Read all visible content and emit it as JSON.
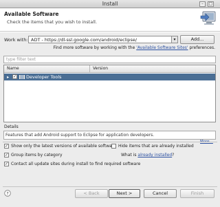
{
  "window": {
    "title": "Install"
  },
  "header": {
    "title": "Available Software",
    "subtitle": "Check the items that you wish to install."
  },
  "work_with": {
    "label": "Work with:",
    "value": "ADT - https://dl-ssl.google.com/android/eclipse/",
    "add_button": "Add...",
    "hint_prefix": "Find more software by working with the",
    "hint_link": "'Available Software Sites'",
    "hint_suffix": "preferences."
  },
  "filter": {
    "placeholder": "type filter text"
  },
  "table": {
    "columns": [
      "Name",
      "Version"
    ],
    "rows": [
      {
        "name": "Developer Tools",
        "version": "",
        "checked": true,
        "selected": true
      }
    ]
  },
  "details": {
    "label": "Details",
    "text": "Features that add Android support to Eclipse for application developers.",
    "more_label": "More..."
  },
  "options": {
    "show_latest": {
      "label": "Show only the latest versions of available software",
      "checked": true
    },
    "hide_installed": {
      "label": "Hide items that are already installed",
      "checked": false
    },
    "group_by_category": {
      "label": "Group items by category",
      "checked": true
    },
    "already_installed_prefix": "What is",
    "already_installed_link": "already installed",
    "already_installed_suffix": "?",
    "contact_sites": {
      "label": "Contact all update sites during install to find required software",
      "checked": true
    }
  },
  "footer": {
    "back": "< Back",
    "next": "Next >",
    "cancel": "Cancel",
    "finish": "Finish"
  },
  "colors": {
    "selection": "#4a6e94",
    "link": "#2a4fa0"
  }
}
